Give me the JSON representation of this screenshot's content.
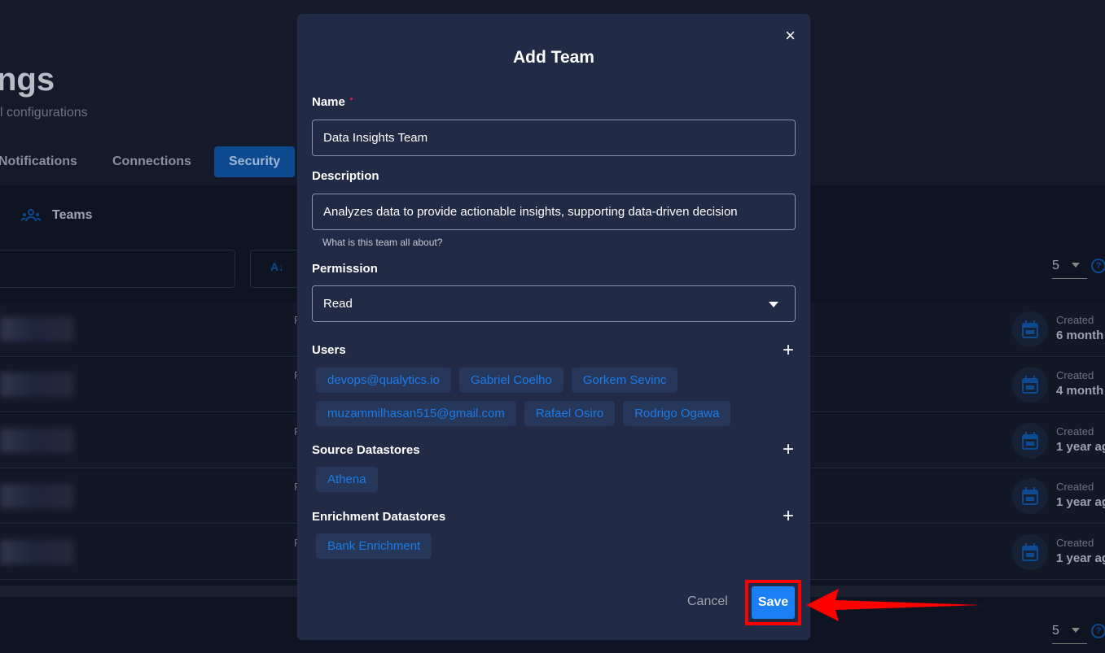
{
  "page": {
    "title": "ngs",
    "subtitle": "l configurations",
    "tabs": [
      {
        "label": "Notifications"
      },
      {
        "label": "Connections"
      },
      {
        "label": "Security",
        "active": true
      }
    ],
    "subnav": {
      "teams_label": "Teams",
      "teams_icon": "users-group-icon"
    },
    "sort_icon": "sort-az-icon",
    "per_page": "5",
    "help_icon": "?",
    "rows": [
      {
        "col_initial": "F",
        "created_label": "Created",
        "created_value": "6 month"
      },
      {
        "col_initial": "F",
        "created_label": "Created",
        "created_value": "4 month"
      },
      {
        "col_initial": "F",
        "created_label": "Created",
        "created_value": "1 year ag"
      },
      {
        "col_initial": "F",
        "created_label": "Created",
        "created_value": "1 year ag"
      },
      {
        "col_initial": "F",
        "created_label": "Created",
        "created_value": "1 year ag"
      }
    ],
    "bottom_per_page": "5"
  },
  "modal": {
    "title": "Add Team",
    "close": "×",
    "name_label": "Name",
    "name_required": "•",
    "name_value": "Data Insights Team",
    "description_label": "Description",
    "description_value": "Analyzes data to provide actionable insights, supporting data-driven decision",
    "description_hint": "What is this team all about?",
    "permission_label": "Permission",
    "permission_value": "Read",
    "users_label": "Users",
    "users": [
      "devops@qualytics.io",
      "Gabriel Coelho",
      "Gorkem Sevinc",
      "muzammilhasan515@gmail.com",
      "Rafael Osiro",
      "Rodrigo Ogawa"
    ],
    "source_label": "Source Datastores",
    "sources": [
      "Athena"
    ],
    "enrichment_label": "Enrichment Datastores",
    "enrichments": [
      "Bank Enrichment"
    ],
    "plus": "+",
    "cancel_label": "Cancel",
    "save_label": "Save"
  },
  "colors": {
    "accent": "#1a7ef5",
    "chip_text": "#1e7ae6",
    "highlight": "#ff0000",
    "modal_bg": "#222b45"
  }
}
